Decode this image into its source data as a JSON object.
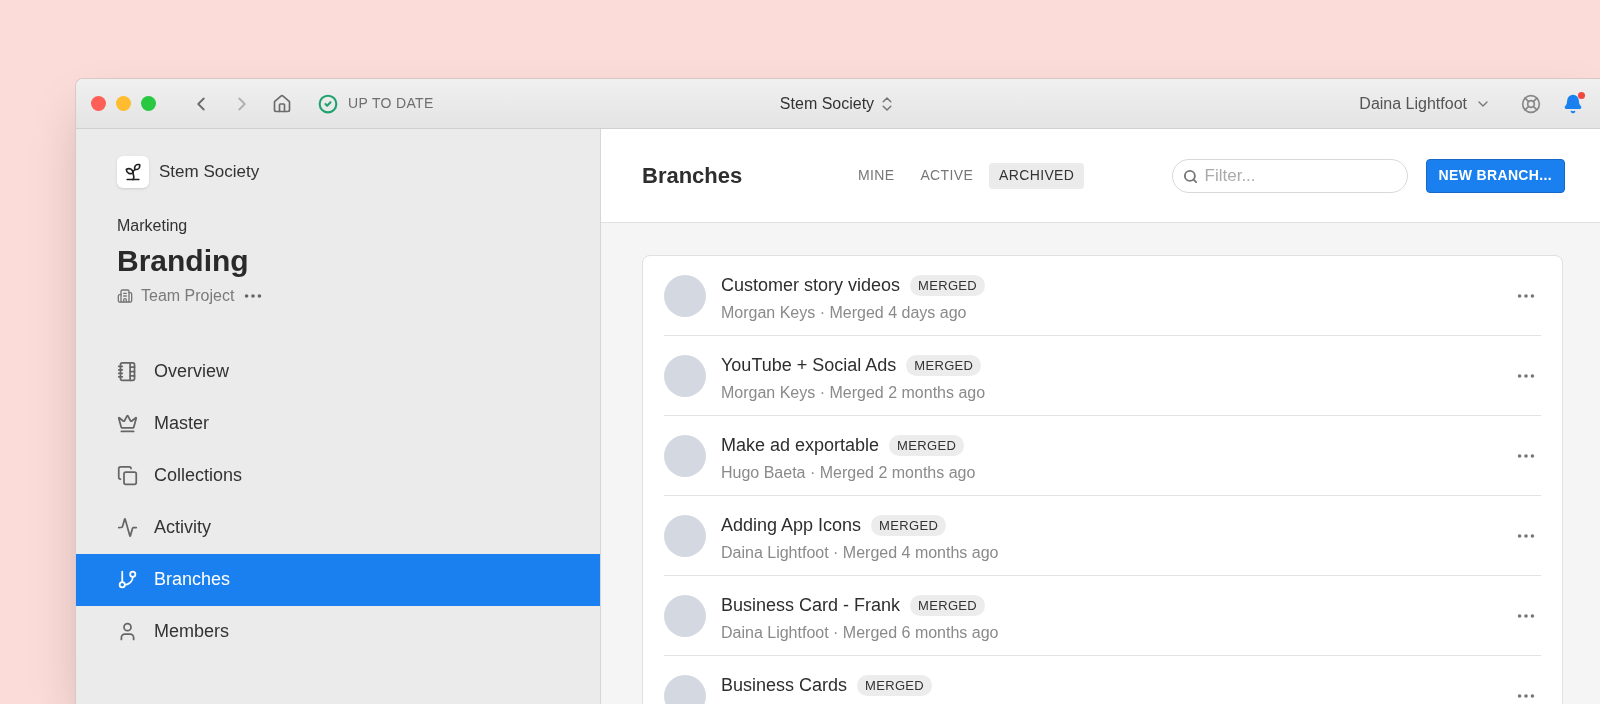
{
  "titlebar": {
    "sync_status": "UP TO DATE",
    "workspace": "Stem Society",
    "user": "Daina Lightfoot",
    "notifications_unread": true
  },
  "sidebar": {
    "org": "Stem Society",
    "group": "Marketing",
    "project": "Branding",
    "project_type": "Team Project",
    "items": [
      {
        "label": "Overview",
        "selected": false
      },
      {
        "label": "Master",
        "selected": false
      },
      {
        "label": "Collections",
        "selected": false
      },
      {
        "label": "Activity",
        "selected": false
      },
      {
        "label": "Branches",
        "selected": true
      },
      {
        "label": "Members",
        "selected": false
      }
    ]
  },
  "main": {
    "title": "Branches",
    "tabs": [
      {
        "label": "MINE",
        "selected": false
      },
      {
        "label": "ACTIVE",
        "selected": false
      },
      {
        "label": "ARCHIVED",
        "selected": true
      }
    ],
    "filter": {
      "placeholder": "Filter..."
    },
    "new_button": "NEW BRANCH...",
    "branches": [
      {
        "title": "Customer story videos",
        "badge": "MERGED",
        "subtitle": "Morgan Keys · Merged 4 days ago"
      },
      {
        "title": "YouTube + Social Ads",
        "badge": "MERGED",
        "subtitle": "Morgan Keys · Merged 2 months ago"
      },
      {
        "title": "Make ad exportable",
        "badge": "MERGED",
        "subtitle": "Hugo Baeta · Merged 2 months ago"
      },
      {
        "title": "Adding App Icons",
        "badge": "MERGED",
        "subtitle": "Daina Lightfoot · Merged 4 months ago"
      },
      {
        "title": "Business Card - Frank",
        "badge": "MERGED",
        "subtitle": "Daina Lightfoot · Merged 6 months ago"
      },
      {
        "title": "Business Cards",
        "badge": "MERGED"
      }
    ]
  }
}
